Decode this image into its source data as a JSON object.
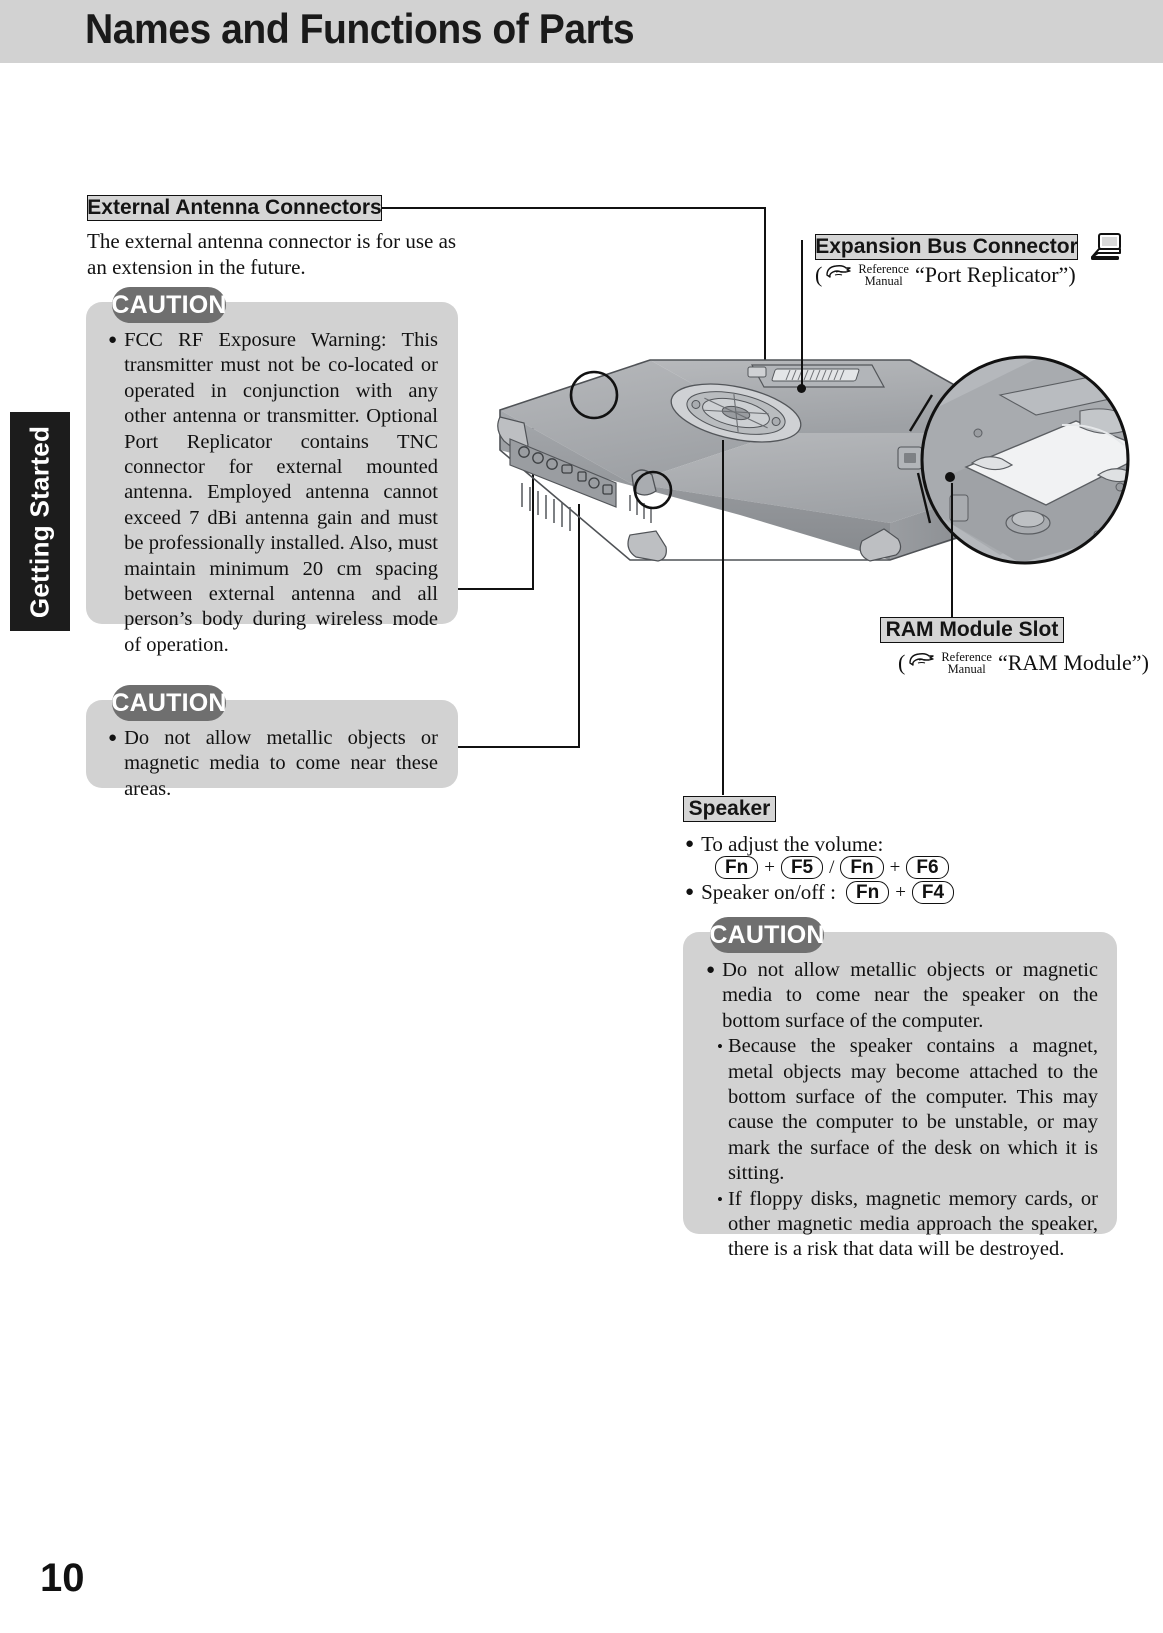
{
  "page": {
    "title": "Names and Functions of Parts",
    "side_tab": "Getting Started",
    "page_number": "10"
  },
  "labels": {
    "external_antenna": "External Antenna Connectors",
    "expansion_bus": "Expansion Bus Connector",
    "ram_module_slot": "RAM Module Slot",
    "speaker": "Speaker"
  },
  "external_antenna": {
    "body": "The external antenna connector is for use as an extension in the future.",
    "caution": {
      "badge": "CAUTION",
      "bullets": [
        "FCC RF Exposure Warning: This transmitter must not be co-located or operated in conjunction with any other antenna or transmitter. Optional Port Replicator contains TNC connector for external mounted antenna. Employed antenna cannot exceed 7 dBi antenna gain and must be professionally installed.  Also, must maintain minimum 20 cm spacing between external antenna and all person’s body during wireless mode of operation."
      ]
    }
  },
  "metallic_caution": {
    "badge": "CAUTION",
    "bullets": [
      "Do not allow metallic objects or magnetic media to come near these areas."
    ]
  },
  "expansion_bus": {
    "reference_prefix": "(",
    "reference_word_top": "Reference",
    "reference_word_bottom": "Manual",
    "reference_target": "“Port Replicator”)",
    "icon": "laptop-icon"
  },
  "ram_module": {
    "reference_prefix": "(",
    "reference_word_top": "Reference",
    "reference_word_bottom": "Manual",
    "reference_target": "“RAM Module”)"
  },
  "speaker": {
    "volume_label": "To adjust the volume:",
    "volume_keys": [
      "Fn",
      "F5",
      "Fn",
      "F6"
    ],
    "volume_separator": "/",
    "onoff_label": "Speaker on/off :",
    "onoff_keys": [
      "Fn",
      "F4"
    ],
    "plus": "+",
    "caution": {
      "badge": "CAUTION",
      "bullets": [
        "Do not allow metallic objects or magnetic media to come near the speaker on the bottom surface of the computer."
      ],
      "sub_bullets": [
        "Because the speaker contains a magnet, metal objects may become attached to the bottom surface of the computer.  This may cause the computer to be unstable, or may mark the surface of the desk on which it is sitting.",
        "If floppy disks, magnetic memory cards, or other magnetic media approach the speaker, there is a risk that data will be destroyed."
      ],
      "sub_marker": "•"
    }
  },
  "colors": {
    "header_band": "#d2d2d2",
    "label_fill": "#d5d5d5",
    "caution_fill": "#d2d2d2",
    "caution_badge": "#6f6f6f",
    "side_tab": "#1c1c1c",
    "ink": "#111111"
  }
}
